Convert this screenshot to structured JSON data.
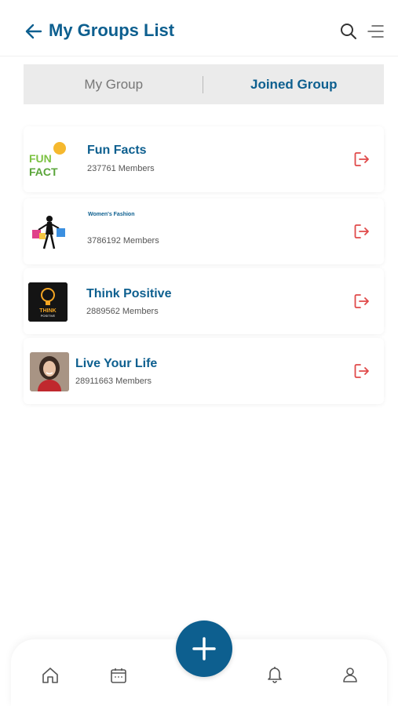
{
  "header": {
    "title": "My Groups List",
    "back_icon": "arrow-left-icon",
    "search_icon": "search-icon",
    "menu_icon": "menu-lines-icon"
  },
  "tabs": [
    {
      "label": "My Group",
      "active": false
    },
    {
      "label": "Joined Group",
      "active": true
    }
  ],
  "groups": [
    {
      "name": "Fun Facts",
      "members": "237761 Members",
      "thumb_text": [
        "FUN",
        "FACT"
      ]
    },
    {
      "name": "Women's Fashion",
      "members": "3786192 Members"
    },
    {
      "name": "Think Positive",
      "members": "2889562 Members",
      "thumb_text": [
        "THINK",
        "POSITIVE"
      ]
    },
    {
      "name": "Live Your Life",
      "members": "28911663 Members"
    }
  ],
  "bottom_nav": {
    "items": [
      "home-icon",
      "calendar-icon",
      "bell-icon",
      "user-icon"
    ],
    "fab_icon": "plus-icon"
  },
  "colors": {
    "primary": "#0d5f8f",
    "leave": "#e04a4a",
    "tab_bg": "#ebebeb"
  }
}
